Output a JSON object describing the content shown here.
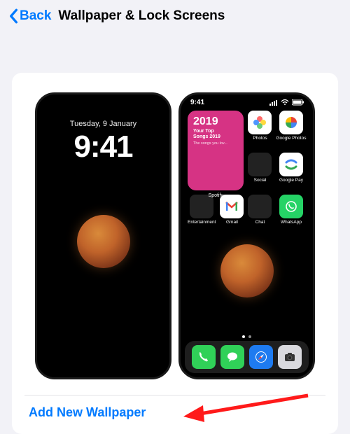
{
  "header": {
    "back_label": "Back",
    "title": "Wallpaper & Lock Screens"
  },
  "lock_screen": {
    "date": "Tuesday, 9 January",
    "time": "9:41"
  },
  "home_screen": {
    "status_time": "9:41",
    "widget": {
      "year": "2019",
      "line1": "Your Top",
      "line2": "Songs 2019",
      "subtitle": "The songs you lov...",
      "app_label": "Spotify"
    },
    "apps": [
      {
        "name": "Photos",
        "label": "Photos"
      },
      {
        "name": "Google Photos",
        "label": "Google Photos"
      },
      {
        "name": "Social",
        "label": "Social"
      },
      {
        "name": "Google Pay",
        "label": "Google Pay"
      },
      {
        "name": "Entertainment",
        "label": "Entertainment"
      },
      {
        "name": "Gmail",
        "label": "Gmail"
      },
      {
        "name": "Chat",
        "label": "Chat"
      },
      {
        "name": "WhatsApp",
        "label": "WhatsApp"
      }
    ],
    "dock": [
      "Phone",
      "Messages",
      "Safari",
      "Camera"
    ]
  },
  "actions": {
    "add_new": "Add New Wallpaper"
  },
  "colors": {
    "accent": "#007aff",
    "widget_bg": "#d63384"
  }
}
